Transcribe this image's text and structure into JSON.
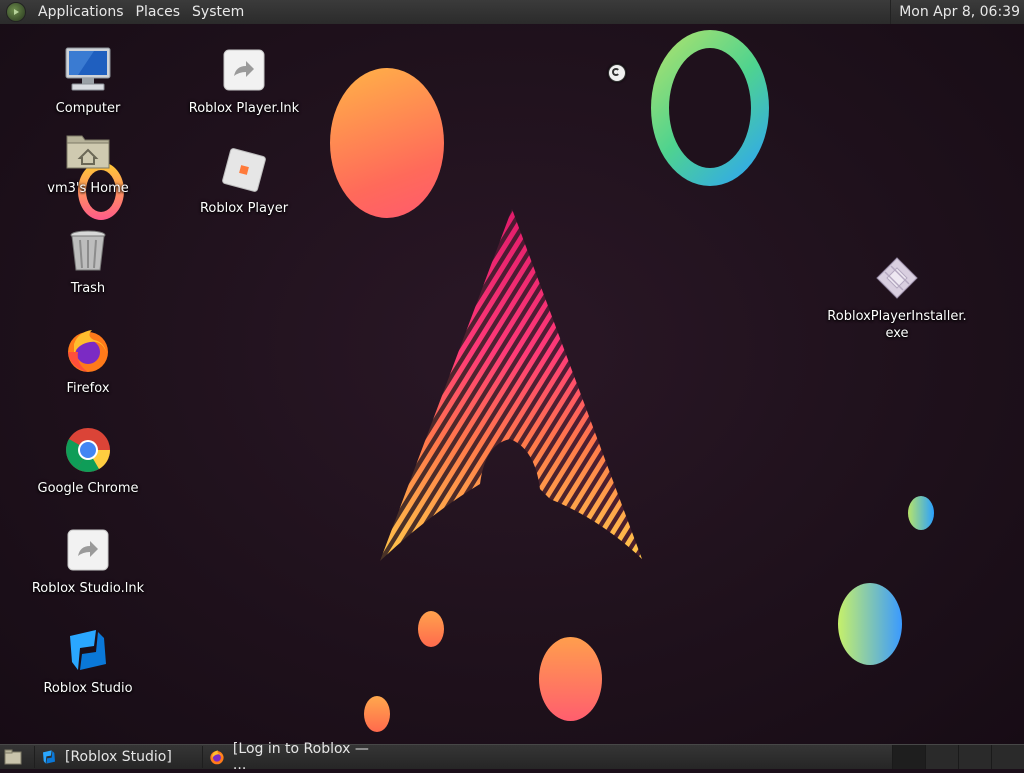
{
  "top_panel": {
    "menus": [
      "Applications",
      "Places",
      "System"
    ],
    "clock": "Mon Apr  8, 06:39"
  },
  "desktop_icons": [
    {
      "label": "Computer",
      "icon": "computer-icon"
    },
    {
      "label": "vm3's Home",
      "icon": "home-folder-icon"
    },
    {
      "label": "Trash",
      "icon": "trash-icon"
    },
    {
      "label": "Firefox",
      "icon": "firefox-icon"
    },
    {
      "label": "Google Chrome",
      "icon": "chrome-icon"
    },
    {
      "label": "Roblox Studio.lnk",
      "icon": "shortcut-icon"
    },
    {
      "label": "Roblox Studio",
      "icon": "roblox-studio-icon"
    },
    {
      "label": "Roblox Player.lnk",
      "icon": "shortcut-icon"
    },
    {
      "label": "Roblox Player",
      "icon": "roblox-player-icon"
    },
    {
      "label": "RobloxPlayerInstaller.\nexe",
      "icon": "exe-file-icon"
    }
  ],
  "taskbar": {
    "tasks": [
      {
        "label": "[Roblox Studio]",
        "icon": "roblox-studio-icon"
      },
      {
        "label": "[Log in to Roblox — ...",
        "icon": "firefox-icon"
      }
    ],
    "workspace_count": 4
  }
}
